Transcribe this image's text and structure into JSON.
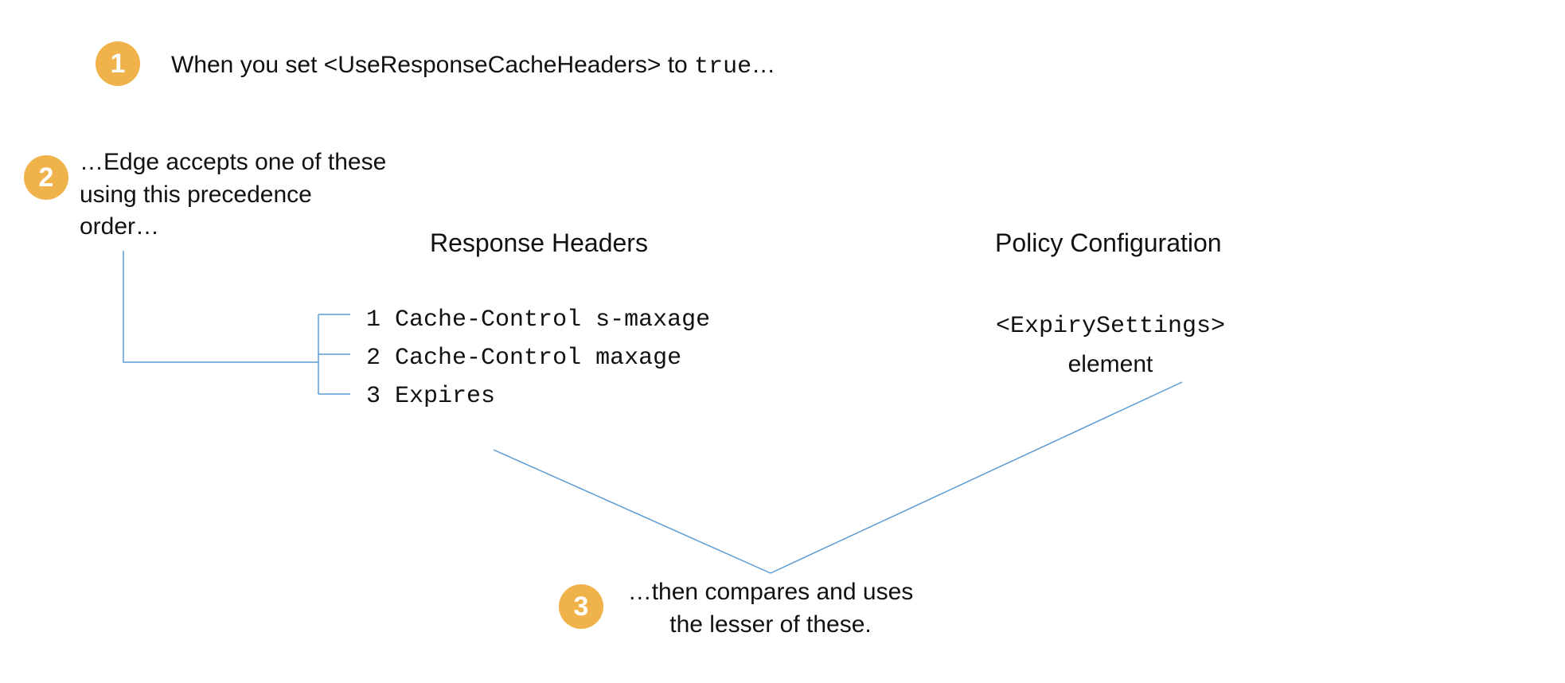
{
  "badges": {
    "one": "1",
    "two": "2",
    "three": "3"
  },
  "step1": {
    "prefix": "When you set ",
    "tag": "<UseResponseCacheHeaders>",
    "mid": " to ",
    "value": "true",
    "suffix": "…"
  },
  "step2": {
    "line1": "…Edge accepts one of these",
    "line2": "using this precedence",
    "line3": "order…"
  },
  "responseHeaders": {
    "title": "Response Headers",
    "items": [
      {
        "num": "1",
        "label": "Cache-Control s-maxage"
      },
      {
        "num": "2",
        "label": "Cache-Control maxage"
      },
      {
        "num": "3",
        "label": "Expires"
      }
    ]
  },
  "policy": {
    "title": "Policy Configuration",
    "tag": "<ExpirySettings>",
    "word": "element"
  },
  "step3": {
    "line1": "…then compares and uses",
    "line2": "the lesser of these."
  },
  "colors": {
    "badge": "#f0b24a",
    "connector": "#5b9bd5"
  }
}
